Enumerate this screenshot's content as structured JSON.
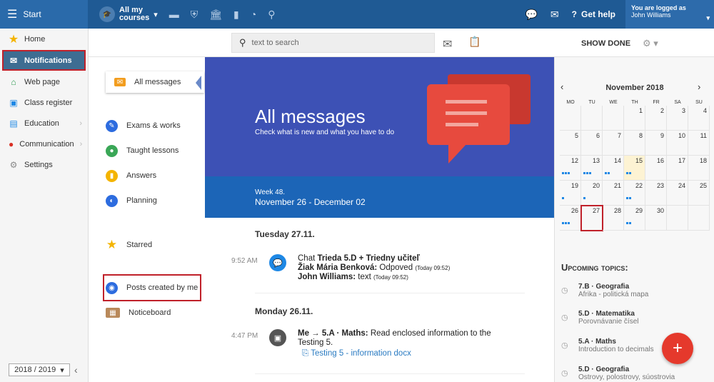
{
  "topbar": {
    "start_label": "Start",
    "courses_label_1": "All my",
    "courses_label_2": "courses",
    "help_label": "Get help",
    "logged_label": "You are logged as",
    "user_name": "John Williams"
  },
  "sidebar": {
    "items": [
      {
        "label": "Home",
        "icon": "star-icon"
      },
      {
        "label": "Notifications",
        "icon": "envelope-icon"
      },
      {
        "label": "Web page",
        "icon": "home-icon"
      },
      {
        "label": "Class register",
        "icon": "notebook-icon"
      },
      {
        "label": "Education",
        "icon": "book-icon"
      },
      {
        "label": "Communication",
        "icon": "chat-icon"
      },
      {
        "label": "Settings",
        "icon": "gear-icon"
      }
    ],
    "year": "2018 / 2019"
  },
  "toolbar": {
    "search_placeholder": "text to search",
    "show_done": "SHOW DONE"
  },
  "leftlist": {
    "items": [
      "All messages",
      "Exams & works",
      "Taught lessons",
      "Answers",
      "Planning",
      "Starred",
      "Posts created by me",
      "Noticeboard"
    ]
  },
  "main": {
    "title": "All messages",
    "subtitle": "Check what is new and what you have to do",
    "week_label": "Week 48.",
    "week_range": "November 26 - December 02",
    "day1": "Tuesday 27.11.",
    "msg1_time": "9:52 AM",
    "msg1_chat": "Chat",
    "msg1_group": "Trieda 5.D + Triedny učiteľ",
    "msg1_author": "Žiak Mária Benková:",
    "msg1_text": "Odpoved",
    "msg1_stamp": "(Today 09:52)",
    "msg1_author2": "John Williams:",
    "msg1_text2": "text",
    "msg1_stamp2": "(Today 09:52)",
    "day2": "Monday 26.11.",
    "msg2_time": "4:47 PM",
    "msg2_head": "Me → 5.A · Maths:",
    "msg2_text": "Read enclosed information to the Testing 5.",
    "msg2_attach": "Testing 5 - information docx"
  },
  "calendar": {
    "month": "November 2018",
    "dow": [
      "MO",
      "TU",
      "WE",
      "TH",
      "FR",
      "SA",
      "SU"
    ],
    "weeks": [
      [
        "",
        "",
        "",
        "1",
        "2",
        "3",
        "4"
      ],
      [
        "5",
        "6",
        "7",
        "8",
        "9",
        "10",
        "11"
      ],
      [
        "12",
        "13",
        "14",
        "15",
        "16",
        "17",
        "18"
      ],
      [
        "19",
        "20",
        "21",
        "22",
        "23",
        "24",
        "25"
      ],
      [
        "26",
        "27",
        "28",
        "29",
        "30",
        "",
        ""
      ]
    ]
  },
  "upcoming": {
    "title": "Upcoming topics:",
    "topics": [
      {
        "class": "7.B · Geografia",
        "desc": "Afrika - politická mapa"
      },
      {
        "class": "5.D · Matematika",
        "desc": "Porovnávanie čísel"
      },
      {
        "class": "5.A · Maths",
        "desc": "Introduction to decimals"
      },
      {
        "class": "5.D · Geografia",
        "desc": "Ostrovy, polostrovy, súostrovia"
      }
    ]
  },
  "fab_label": "+"
}
